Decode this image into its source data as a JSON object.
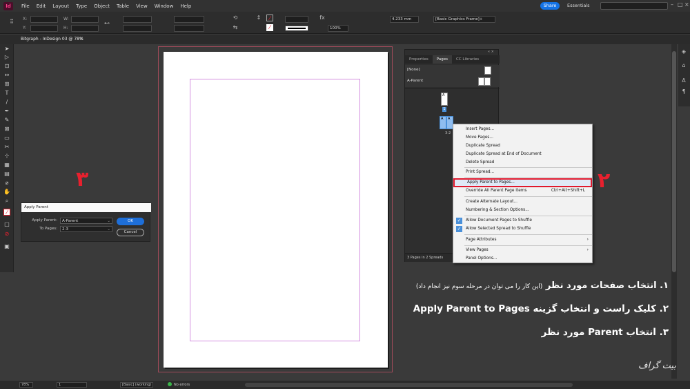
{
  "menubar": {
    "logo": "Id",
    "items": [
      "File",
      "Edit",
      "Layout",
      "Type",
      "Object",
      "Table",
      "View",
      "Window",
      "Help"
    ],
    "share": "Share",
    "workspace": "Essentials"
  },
  "controlbar": {
    "x_label": "X:",
    "y_label": "Y:",
    "w_label": "W:",
    "h_label": "H:",
    "stroke_weight": "4.233 mm",
    "zoom": "100%",
    "object_style": "[Basic Graphics Frame]+"
  },
  "doc_tab": {
    "title": "Bitgraph - InDesign 03 @ 78%"
  },
  "dialog": {
    "title": "Apply Parent",
    "apply_parent_label": "Apply Parent:",
    "apply_parent_value": "A-Parent",
    "to_pages_label": "To Pages:",
    "to_pages_value": "2-3",
    "ok": "OK",
    "cancel": "Cancel"
  },
  "pages_panel": {
    "tabs": [
      "Properties",
      "Pages",
      "CC Libraries"
    ],
    "none_parent": "[None]",
    "a_parent": "A-Parent",
    "page1_label": "1",
    "spread_label": "3-2",
    "status": "3 Pages in 2 Spreads"
  },
  "context_menu": {
    "items": [
      {
        "label": "Insert Pages..."
      },
      {
        "label": "Move Pages..."
      },
      {
        "label": "Duplicate Spread"
      },
      {
        "label": "Duplicate Spread at End of Document"
      },
      {
        "label": "Delete Spread"
      },
      {
        "label": "Print Spread..."
      },
      {
        "label": "Apply Parent to Pages..."
      },
      {
        "label": "Override All Parent Page Items",
        "shortcut": "Ctrl+Alt+Shift+L"
      },
      {
        "label": "Create Alternate Layout..."
      },
      {
        "label": "Numbering & Section Options..."
      },
      {
        "label": "Allow Document Pages to Shuffle"
      },
      {
        "label": "Allow Selected Spread to Shuffle"
      },
      {
        "label": "Page Attributes"
      },
      {
        "label": "View Pages"
      },
      {
        "label": "Panel Options..."
      }
    ]
  },
  "steps": {
    "one": "۱",
    "two": "۲",
    "three": "۳"
  },
  "instructions": {
    "line1_main": "۱. انتخاب صفحات مورد نظر",
    "line1_note": "(این کار را می توان در مرحله سوم نیز انجام داد)",
    "line2": "۲. کلیک راست و انتخاب گزینه Apply Parent to Pages",
    "line3": "۳. انتخاب Parent مورد نظر"
  },
  "statusbar": {
    "zoom": "78%",
    "page": "1",
    "style": "[Basic] (working)",
    "errors": "No errors"
  },
  "watermark": "بیت گراف",
  "colors": {
    "accent_red": "#e8202e",
    "highlight_blue": "#1473e6"
  }
}
